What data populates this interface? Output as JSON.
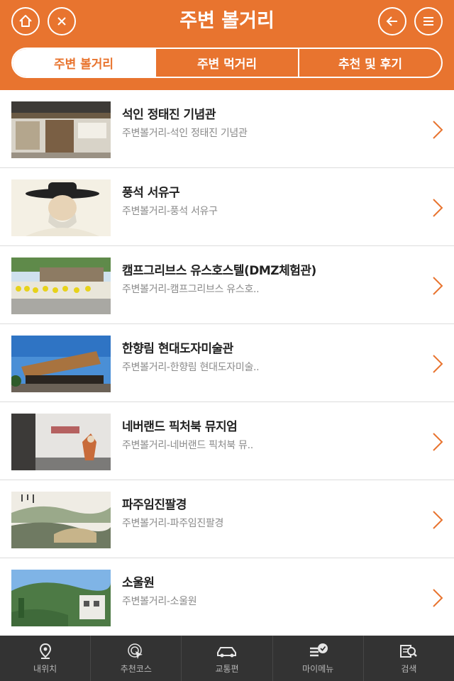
{
  "header": {
    "title": "주변 볼거리",
    "left_icons": [
      "home-icon",
      "close-icon"
    ],
    "right_icons": [
      "back-arrow-icon",
      "menu-icon"
    ],
    "accent_color": "#e8742f"
  },
  "tabs": [
    {
      "label": "주변 볼거리",
      "active": true
    },
    {
      "label": "주변 먹거리",
      "active": false
    },
    {
      "label": "추천 및 후기",
      "active": false
    }
  ],
  "items": [
    {
      "title": "석인 정태진 기념관",
      "subtitle": "주변볼거리-석인 정태진 기념관"
    },
    {
      "title": "풍석 서유구",
      "subtitle": "주변볼거리-풍석 서유구"
    },
    {
      "title": "캠프그리브스 유스호스텔(DMZ체험관)",
      "subtitle": "주변볼거리-캠프그리브스 유스호.."
    },
    {
      "title": "한향림 현대도자미술관",
      "subtitle": "주변볼거리-한향림 현대도자미술.."
    },
    {
      "title": "네버랜드 픽처북 뮤지엄",
      "subtitle": "주변볼거리-네버랜드 픽처북 뮤.."
    },
    {
      "title": "파주임진팔경",
      "subtitle": "주변볼거리-파주임진팔경"
    },
    {
      "title": "소울원",
      "subtitle": "주변볼거리-소울원"
    }
  ],
  "bottom_nav": [
    {
      "label": "내위치",
      "icon": "location-pin-icon"
    },
    {
      "label": "추천코스",
      "icon": "target-cursor-icon"
    },
    {
      "label": "교통편",
      "icon": "car-icon"
    },
    {
      "label": "마이메뉴",
      "icon": "my-menu-icon"
    },
    {
      "label": "검색",
      "icon": "search-icon"
    }
  ]
}
